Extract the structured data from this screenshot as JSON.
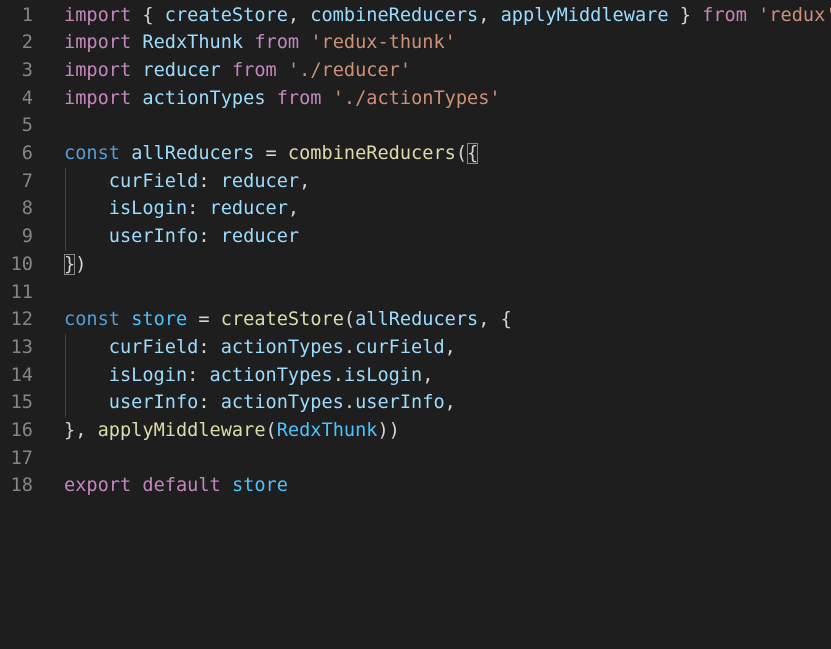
{
  "editor": {
    "line_numbers": [
      "1",
      "2",
      "3",
      "4",
      "5",
      "6",
      "7",
      "8",
      "9",
      "10",
      "11",
      "12",
      "13",
      "14",
      "15",
      "16",
      "17",
      "18"
    ],
    "colors": {
      "background": "#1e1e1e",
      "keyword": "#c586c0",
      "string": "#ce9178",
      "variable": "#9cdcfe",
      "function": "#dcdcaa",
      "storage": "#569cd6",
      "constant": "#4fc1ff",
      "punctuation": "#d4d4d4",
      "line_number": "#858585"
    },
    "lines": [
      [
        [
          "k",
          "import"
        ],
        [
          "p",
          " { "
        ],
        [
          "v",
          "createStore"
        ],
        [
          "p",
          ", "
        ],
        [
          "v",
          "combineReducers"
        ],
        [
          "p",
          ", "
        ],
        [
          "v",
          "applyMiddleware"
        ],
        [
          "p",
          " } "
        ],
        [
          "k",
          "from"
        ],
        [
          "p",
          " "
        ],
        [
          "s",
          "'redux'"
        ]
      ],
      [
        [
          "k",
          "import"
        ],
        [
          "p",
          " "
        ],
        [
          "v",
          "RedxThunk"
        ],
        [
          "p",
          " "
        ],
        [
          "k",
          "from"
        ],
        [
          "p",
          " "
        ],
        [
          "s",
          "'redux-thunk'"
        ]
      ],
      [
        [
          "k",
          "import"
        ],
        [
          "p",
          " "
        ],
        [
          "v",
          "reducer"
        ],
        [
          "p",
          " "
        ],
        [
          "k",
          "from"
        ],
        [
          "p",
          " "
        ],
        [
          "s",
          "'./reducer'"
        ]
      ],
      [
        [
          "k",
          "import"
        ],
        [
          "p",
          " "
        ],
        [
          "v",
          "actionTypes"
        ],
        [
          "p",
          " "
        ],
        [
          "k",
          "from"
        ],
        [
          "p",
          " "
        ],
        [
          "s",
          "'./actionTypes'"
        ]
      ],
      [],
      [
        [
          "c",
          "const"
        ],
        [
          "p",
          " "
        ],
        [
          "v",
          "allReducers"
        ],
        [
          "p",
          " = "
        ],
        [
          "f",
          "combineReducers"
        ],
        [
          "p",
          "("
        ],
        [
          "pb",
          "{"
        ]
      ],
      [
        [
          "p",
          "    "
        ],
        [
          "v",
          "curField"
        ],
        [
          "p",
          ": "
        ],
        [
          "v",
          "reducer"
        ],
        [
          "p",
          ","
        ]
      ],
      [
        [
          "p",
          "    "
        ],
        [
          "v",
          "isLogin"
        ],
        [
          "p",
          ": "
        ],
        [
          "v",
          "reducer"
        ],
        [
          "p",
          ","
        ]
      ],
      [
        [
          "p",
          "    "
        ],
        [
          "v",
          "userInfo"
        ],
        [
          "p",
          ": "
        ],
        [
          "v",
          "reducer"
        ]
      ],
      [
        [
          "pb",
          "}"
        ],
        [
          "p",
          ")"
        ]
      ],
      [],
      [
        [
          "c",
          "const"
        ],
        [
          "p",
          " "
        ],
        [
          "t",
          "store"
        ],
        [
          "p",
          " = "
        ],
        [
          "f",
          "createStore"
        ],
        [
          "p",
          "("
        ],
        [
          "v",
          "allReducers"
        ],
        [
          "p",
          ", {"
        ]
      ],
      [
        [
          "p",
          "    "
        ],
        [
          "v",
          "curField"
        ],
        [
          "p",
          ": "
        ],
        [
          "v",
          "actionTypes"
        ],
        [
          "p",
          "."
        ],
        [
          "v",
          "curField"
        ],
        [
          "p",
          ","
        ]
      ],
      [
        [
          "p",
          "    "
        ],
        [
          "v",
          "isLogin"
        ],
        [
          "p",
          ": "
        ],
        [
          "v",
          "actionTypes"
        ],
        [
          "p",
          "."
        ],
        [
          "v",
          "isLogin"
        ],
        [
          "p",
          ","
        ]
      ],
      [
        [
          "p",
          "    "
        ],
        [
          "v",
          "userInfo"
        ],
        [
          "p",
          ": "
        ],
        [
          "v",
          "actionTypes"
        ],
        [
          "p",
          "."
        ],
        [
          "v",
          "userInfo"
        ],
        [
          "p",
          ","
        ]
      ],
      [
        [
          "p",
          "}, "
        ],
        [
          "f",
          "applyMiddleware"
        ],
        [
          "p",
          "("
        ],
        [
          "t",
          "RedxThunk"
        ],
        [
          "p",
          "))"
        ]
      ],
      [],
      [
        [
          "k",
          "export"
        ],
        [
          "p",
          " "
        ],
        [
          "k",
          "default"
        ],
        [
          "p",
          " "
        ],
        [
          "t",
          "store"
        ]
      ]
    ]
  }
}
